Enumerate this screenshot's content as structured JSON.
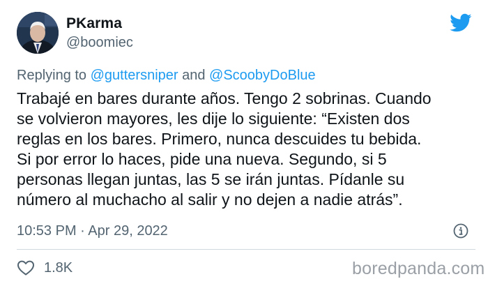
{
  "tweet": {
    "display_name": "PKarma",
    "handle": "@boomiec",
    "reply": {
      "prefix": "Replying to ",
      "mention_1": "@guttersniper",
      "joiner": " and ",
      "mention_2": "@ScoobyDoBlue"
    },
    "body_lines": [
      "Trabajé en bares durante años. Tengo 2 sobrinas. Cuando",
      "se volvieron mayores, les dije lo siguiente: “Existen dos",
      "reglas en los bares. Primero, nunca descuides tu bebida.",
      "Si por error lo haces, pide una nueva. Segundo, si 5",
      "personas llegan juntas, las 5 se irán juntas. Pídanle su",
      "número al muchacho al salir y no dejen a nadie atrás”."
    ],
    "timestamp": "10:53 PM · Apr 29, 2022",
    "likes": "1.8K"
  },
  "watermark": "boredpanda.com",
  "colors": {
    "twitter_blue": "#1d9bf0",
    "secondary_text": "#536471",
    "divider": "#cfd9de"
  },
  "icons": {
    "logo": "twitter-bird-icon",
    "info": "info-circle-icon",
    "like": "heart-outline-icon"
  }
}
